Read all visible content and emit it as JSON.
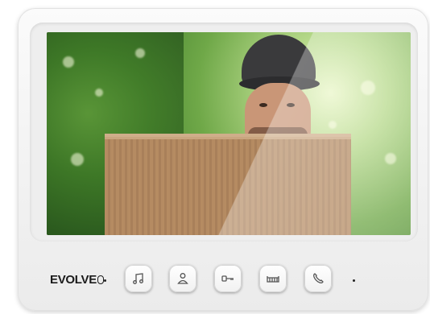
{
  "brand": {
    "name": "EVOLVE"
  },
  "controls": {
    "buttons": [
      {
        "name": "music-button",
        "icon": "music-note-icon"
      },
      {
        "name": "intercom-button",
        "icon": "person-icon"
      },
      {
        "name": "unlock-door-button",
        "icon": "key-icon"
      },
      {
        "name": "gate-button",
        "icon": "gate-icon"
      },
      {
        "name": "call-button",
        "icon": "phone-icon"
      }
    ]
  },
  "colors": {
    "body": "#f2f2f2",
    "text": "#1b1b1b",
    "icon": "#555555"
  }
}
